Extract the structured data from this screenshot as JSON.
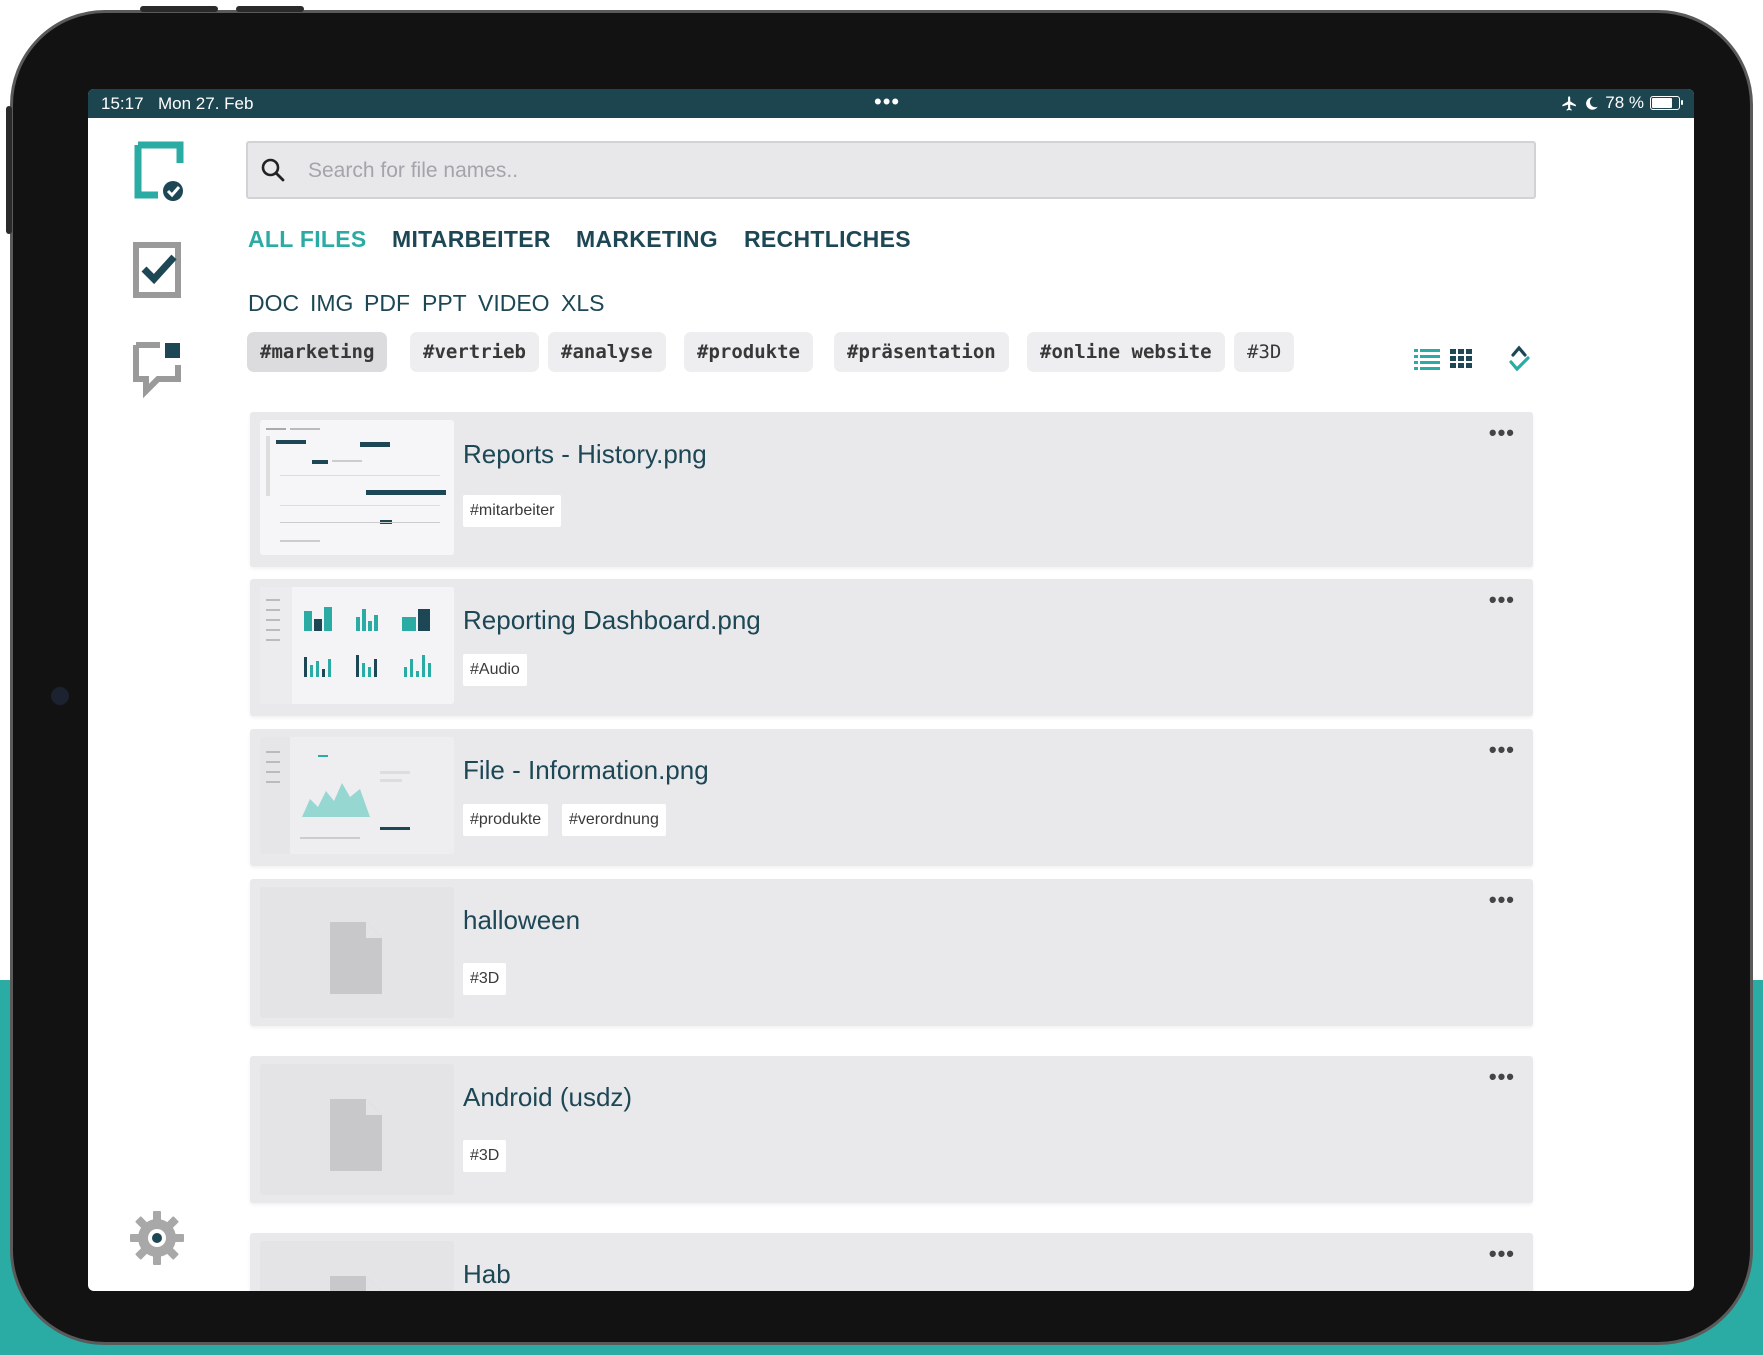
{
  "status_bar": {
    "time": "15:17",
    "date": "Mon 27. Feb",
    "dots": "•••",
    "battery": "78 %"
  },
  "sidebar": {
    "items": [
      {
        "icon": "files-icon"
      },
      {
        "icon": "tasks-check-icon"
      },
      {
        "icon": "chat-icon"
      },
      {
        "icon": "gear-icon"
      }
    ]
  },
  "search": {
    "placeholder": "Search for file names..",
    "value": ""
  },
  "categories": {
    "all": "ALL FILES",
    "mitarbeiter": "MITARBEITER",
    "marketing": "MARKETING",
    "rechtliches": "RECHTLICHES"
  },
  "file_types": {
    "doc": "DOC",
    "img": "IMG",
    "pdf": "PDF",
    "ppt": "PPT",
    "video": "VIDEO",
    "xls": "XLS"
  },
  "tags": {
    "marketing": "#marketing",
    "vertrieb": "#vertrieb",
    "analyse": "#analyse",
    "produkte": "#produkte",
    "praesentation": "#präsentation",
    "online_website": "#online website",
    "threed": "#3D"
  },
  "view_controls": {
    "list": "list-view-icon",
    "grid": "grid-view-icon",
    "sort": "sort-icon"
  },
  "files": [
    {
      "name": "Reports - History.png",
      "tags": [
        "#mitarbeiter"
      ],
      "more": "•••"
    },
    {
      "name": "Reporting Dashboard.png",
      "tags": [
        "#Audio"
      ],
      "more": "•••"
    },
    {
      "name": "File - Information.png",
      "tags": [
        "#produkte",
        "#verordnung"
      ],
      "more": "•••"
    },
    {
      "name": "halloween",
      "tags": [
        "#3D"
      ],
      "more": "•••"
    },
    {
      "name": "Android (usdz)",
      "tags": [
        "#3D"
      ],
      "more": "•••"
    },
    {
      "name": "Hab",
      "tags": [],
      "more": "•••"
    }
  ],
  "colors": {
    "accent": "#2aaba3",
    "navy": "#1d4755",
    "status_bar": "#1c4550",
    "card": "#e9e9ec"
  }
}
